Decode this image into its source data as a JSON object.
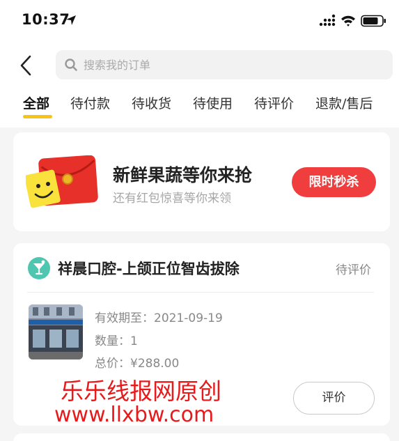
{
  "status_bar": {
    "time": "10:37"
  },
  "search": {
    "placeholder": "搜索我的订单"
  },
  "tabs": [
    {
      "label": "全部",
      "active": true
    },
    {
      "label": "待付款"
    },
    {
      "label": "待收货"
    },
    {
      "label": "待使用"
    },
    {
      "label": "待评价"
    },
    {
      "label": "退款/售后"
    }
  ],
  "promo": {
    "title": "新鲜果蔬等你来抢",
    "subtitle": "还有红包惊喜等你来领",
    "button_label": "限时秒杀"
  },
  "order": {
    "store_name": "祥晨口腔-上颌正位智齿拔除",
    "status": "待评价",
    "valid_until_label": "有效期至：",
    "valid_until": "2021-09-19",
    "quantity_label": "数量：",
    "quantity": "1",
    "total_label": "总价：",
    "total": "¥288.00",
    "review_button_label": "评价"
  },
  "watermark": {
    "line1": "乐乐线报网原创",
    "line2": "www.llxbw.com"
  },
  "colors": {
    "accent": "#f7c318",
    "promo_button": "#f03e3e",
    "watermark": "#e8191a",
    "store_icon": "#4fc7b0"
  }
}
